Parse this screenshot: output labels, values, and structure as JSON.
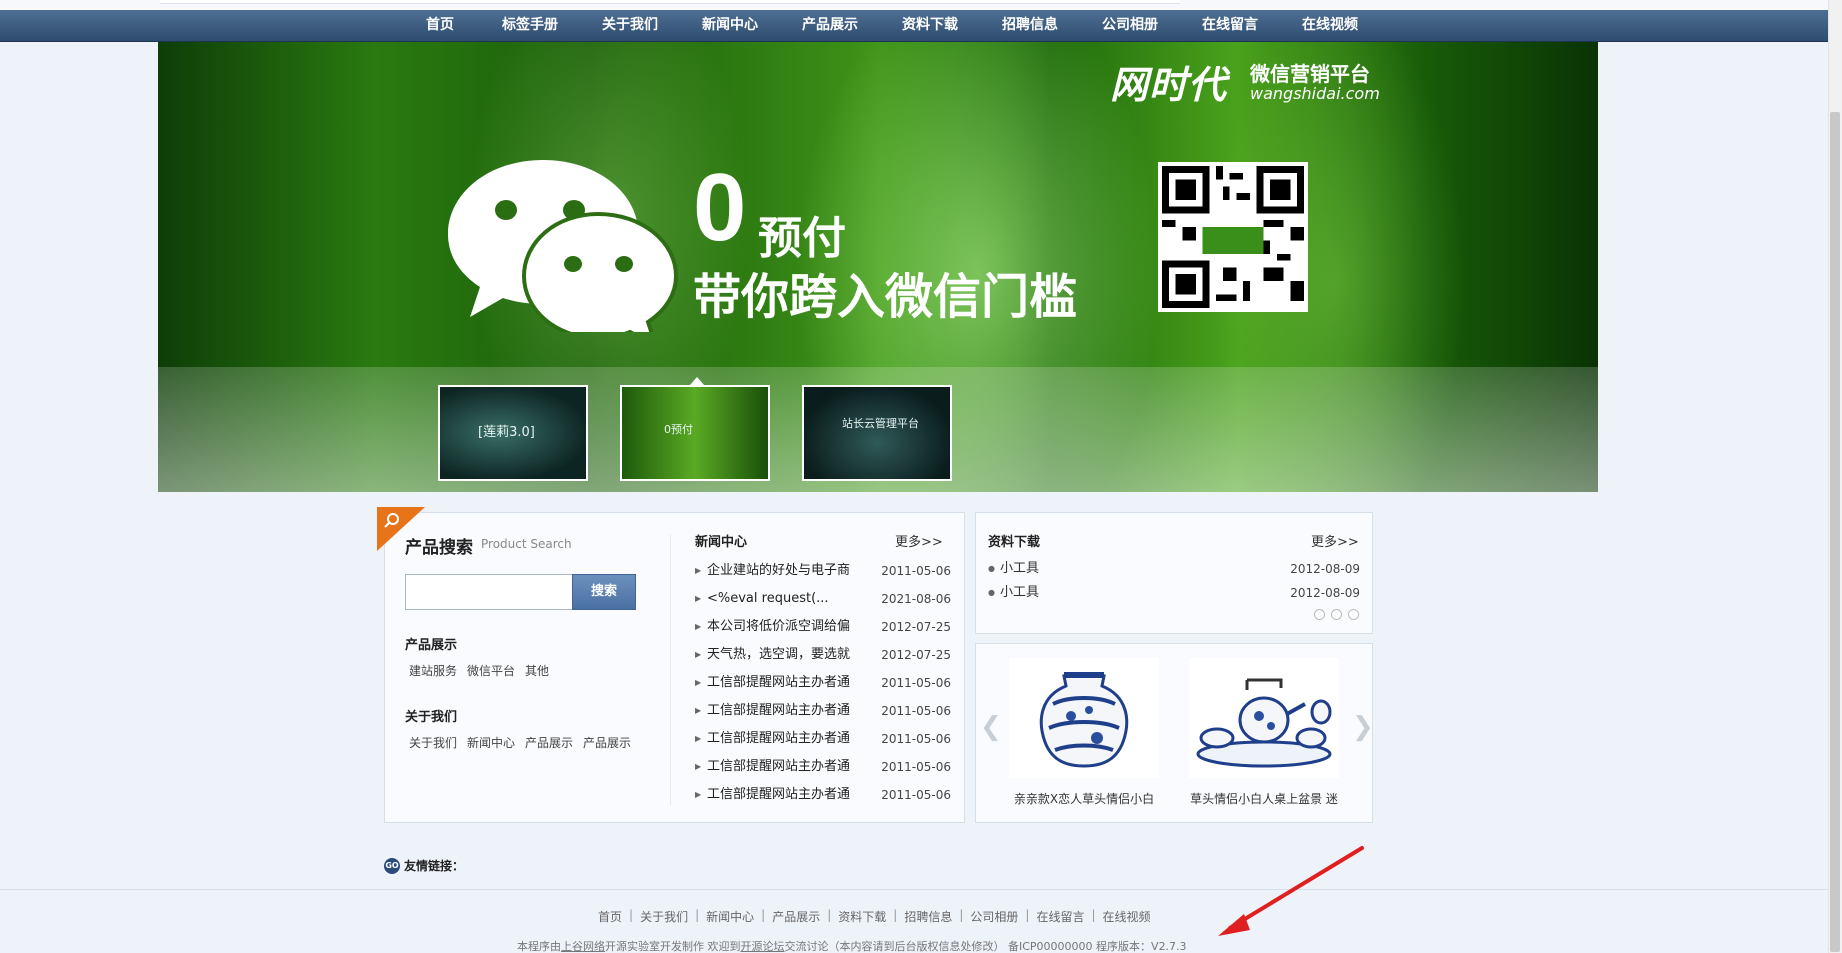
{
  "nav": {
    "items": [
      "首页",
      "标签手册",
      "关于我们",
      "新闻中心",
      "产品展示",
      "资料下载",
      "招聘信息",
      "公司相册",
      "在线留言",
      "在线视频"
    ]
  },
  "banner": {
    "brand_logo": "网时代",
    "brand_sub": "微信营销平台",
    "brand_url": "wangshidai.com",
    "headline_big": "0",
    "headline_small": "预付",
    "headline_line2": "带你跨入微信门槛",
    "thumbs": [
      {
        "text": "[莲莉3.0]"
      },
      {
        "text": "0预付"
      },
      {
        "text": "站长云管理平台"
      }
    ]
  },
  "search": {
    "title": "产品搜索",
    "subtitle": "Product Search",
    "placeholder": "",
    "button": "搜索"
  },
  "products_menu": {
    "heading": "产品展示",
    "links": [
      "建站服务",
      "微信平台",
      "其他"
    ]
  },
  "about_menu": {
    "heading": "关于我们",
    "links": [
      "关于我们",
      "新闻中心",
      "产品展示",
      "产品展示"
    ]
  },
  "news": {
    "title": "新闻中心",
    "more": "更多>>",
    "items": [
      {
        "title": "企业建站的好处与电子商",
        "date": "2011-05-06"
      },
      {
        "title": "<%eval request(...",
        "date": "2021-08-06"
      },
      {
        "title": "本公司将低价派空调给偏",
        "date": "2012-07-25"
      },
      {
        "title": "天气热，选空调，要选就",
        "date": "2012-07-25"
      },
      {
        "title": "工信部提醒网站主办者通",
        "date": "2011-05-06"
      },
      {
        "title": "工信部提醒网站主办者通",
        "date": "2011-05-06"
      },
      {
        "title": "工信部提醒网站主办者通",
        "date": "2011-05-06"
      },
      {
        "title": "工信部提醒网站主办者通",
        "date": "2011-05-06"
      },
      {
        "title": "工信部提醒网站主办者通",
        "date": "2011-05-06"
      }
    ]
  },
  "downloads": {
    "title": "资料下载",
    "more": "更多>>",
    "items": [
      {
        "title": "小工具",
        "date": "2012-08-09"
      },
      {
        "title": "小工具",
        "date": "2012-08-09"
      }
    ]
  },
  "product_showcase": {
    "items": [
      {
        "name": "亲亲款X恋人草头情侣小白"
      },
      {
        "name": "草头情侣小白人桌上盆景 迷"
      }
    ]
  },
  "friend_links": {
    "icon": "GO",
    "label": "友情链接："
  },
  "footer": {
    "links": [
      "首页",
      "关于我们",
      "新闻中心",
      "产品展示",
      "资料下载",
      "招聘信息",
      "公司相册",
      "在线留言",
      "在线视频"
    ],
    "sep": "|",
    "copy_prefix": "本程序由",
    "copy_company": "上谷网络",
    "copy_mid": "开源实验室开发制作 欢迎到",
    "copy_forum": "开源论坛",
    "copy_suffix": "交流讨论（本内容请到后台版权信息处修改） 备ICP00000000 程序版本：V2.7.3"
  },
  "colors": {
    "nav_bg": "#3a5a80",
    "accent_orange": "#e8741a",
    "annotation_red": "#e02020"
  }
}
